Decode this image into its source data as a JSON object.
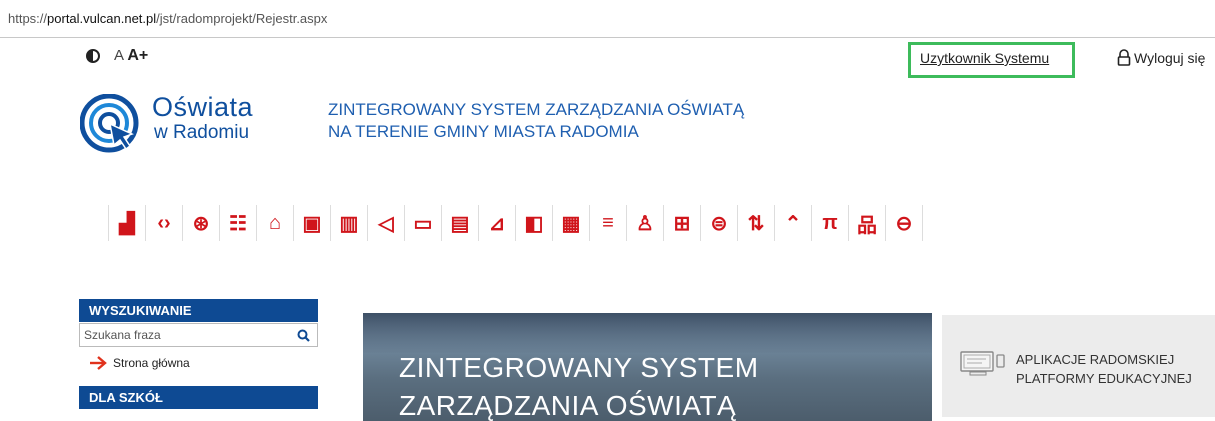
{
  "browser": {
    "url_scheme": "https://",
    "url_host": "portal.vulcan.net.pl",
    "url_path": "/jst/radomprojekt/Rejestr.aspx"
  },
  "accessibility": {
    "font_normal": "A",
    "font_larger": "A+"
  },
  "header": {
    "user_link": "Uzytkownik Systemu",
    "logout": "Wyloguj się"
  },
  "logo": {
    "title": "Oświata",
    "subtitle": "w Radomiu"
  },
  "tagline": {
    "line1": "ZINTEGROWANY SYSTEM ZARZĄDZANIA OŚWIATĄ",
    "line2": "NA TERENIE GMINY MIASTA RADOMIA"
  },
  "toolbar_icons": [
    "chart-icon",
    "network-icon",
    "coin-icon",
    "list-icon",
    "institution-icon",
    "document-icon",
    "books-icon",
    "megaphone-icon",
    "monitor-icon",
    "window-icon",
    "playground-icon",
    "files-icon",
    "calendar-icon",
    "sort-icon",
    "person-icon",
    "briefcase-icon",
    "meal-icon",
    "transfer-icon",
    "home-icon",
    "desk-icon",
    "hierarchy-icon",
    "bus-icon"
  ],
  "sidebar": {
    "search_heading": "WYSZUKIWANIE",
    "search_placeholder": "Szukana fraza",
    "home_link": "Strona główna",
    "schools_heading": "DLA SZKÓŁ"
  },
  "hero": {
    "line1": "ZINTEGROWANY SYSTEM",
    "line2": "ZARZĄDZANIA OŚWIATĄ"
  },
  "app_box": {
    "line1": "APLIKACJE RADOMSKIEJ",
    "line2": "PLATFORMY EDUKACYJNEJ"
  },
  "colors": {
    "brand_blue": "#0e4a93",
    "icon_red": "#d0151b",
    "highlight_green": "#3dbb5b"
  }
}
